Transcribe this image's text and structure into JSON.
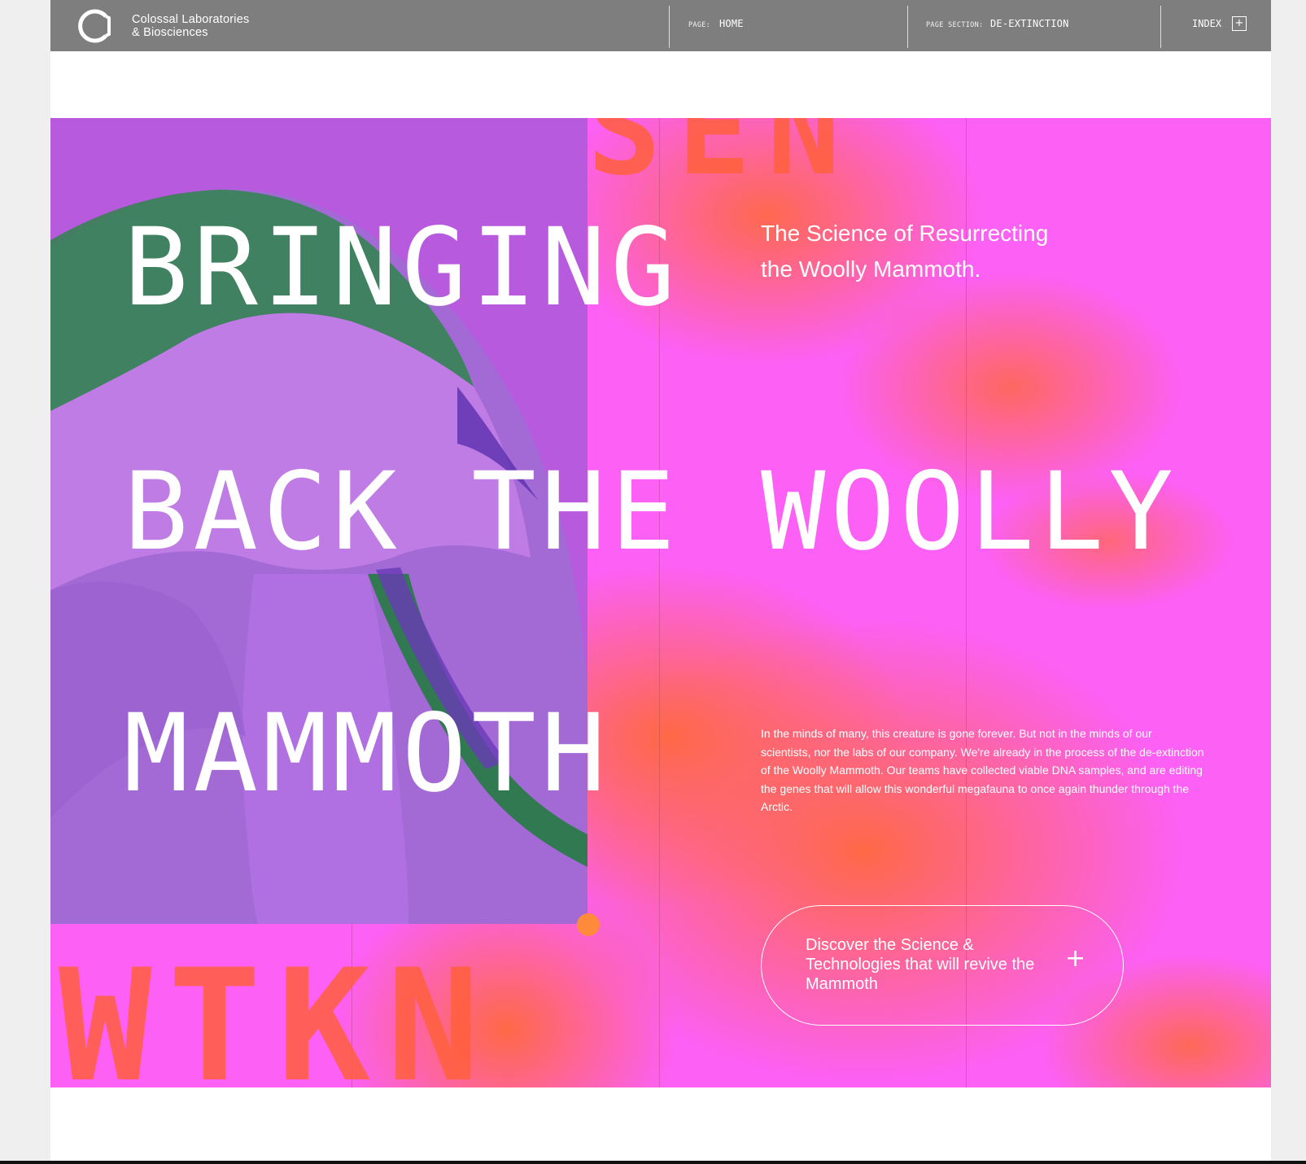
{
  "header": {
    "brand_line1": "Colossal Laboratories",
    "brand_line2": "& Biosciences",
    "logo_icon": "colossal-ring-logo",
    "page_label": "PAGE:",
    "page_value": "HOME",
    "section_label": "PAGE SECTION:",
    "section_value": "DE-EXTINCTION",
    "index_label": "INDEX",
    "index_icon": "+"
  },
  "hero": {
    "headline_line1": "BRINGING",
    "headline_line2a": "BACK THE",
    "headline_line2b": "WOOLLY",
    "headline_line3": "MAMMOTH",
    "subtitle_line1": "The Science of Resurrecting",
    "subtitle_line2": "the Woolly Mammoth.",
    "body": "In the minds of many, this creature is gone forever. But not in the minds of our scientists, nor the labs of our company. We're already in the process of the de-extinction of the Woolly Mammoth. Our teams have collected viable DNA samples, and are editing the genes that will allow this wonderful megafauna to once again thunder through the Arctic.",
    "cta_label": "Discover the Science & Technologies that will revive the Mammoth",
    "cta_icon": "+",
    "image": "woolly-mammoth-photo"
  },
  "colors": {
    "header_bg": "#7e7e7e",
    "magenta": "#fc60f4",
    "orange": "#ff6946",
    "purple": "#b75add",
    "accent_dot": "#ff8a3c"
  }
}
